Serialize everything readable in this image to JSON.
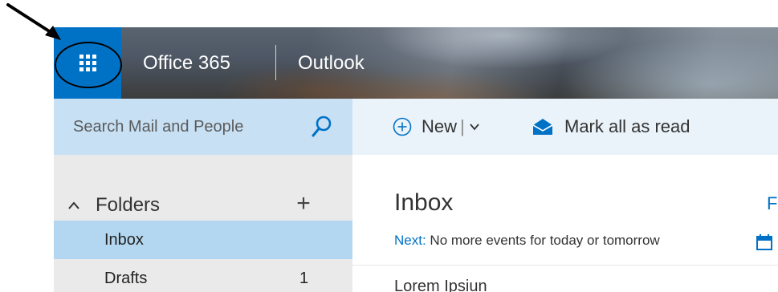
{
  "header": {
    "brand": "Office 365",
    "app_name": "Outlook"
  },
  "search": {
    "placeholder": "Search Mail and People"
  },
  "toolbar": {
    "new_label": "New",
    "separator": "|",
    "mark_all_read_label": "Mark all as read"
  },
  "folders": {
    "section_label": "Folders",
    "add_label": "+",
    "items": [
      {
        "label": "Inbox",
        "count": ""
      },
      {
        "label": "Drafts",
        "count": "1"
      }
    ]
  },
  "inbox": {
    "title": "Inbox",
    "filter_partial": "Fi",
    "next_label": "Next:",
    "next_text": " No more events for today or tomorrow",
    "list_item_partial": "Lorem  Ipsiun"
  },
  "colors": {
    "accent": "#0072c6",
    "search_bg": "#c7e0f4",
    "selected_folder": "#b3d7f0",
    "pane_bg": "#eaeaea"
  },
  "icons": {
    "app_launcher": "waffle-icon",
    "search": "search-icon",
    "new": "plus-circle-icon",
    "dropdown": "chevron-down-icon",
    "mark_read": "envelope-open-icon",
    "collapse": "chevron-up-icon",
    "calendar": "calendar-icon"
  }
}
